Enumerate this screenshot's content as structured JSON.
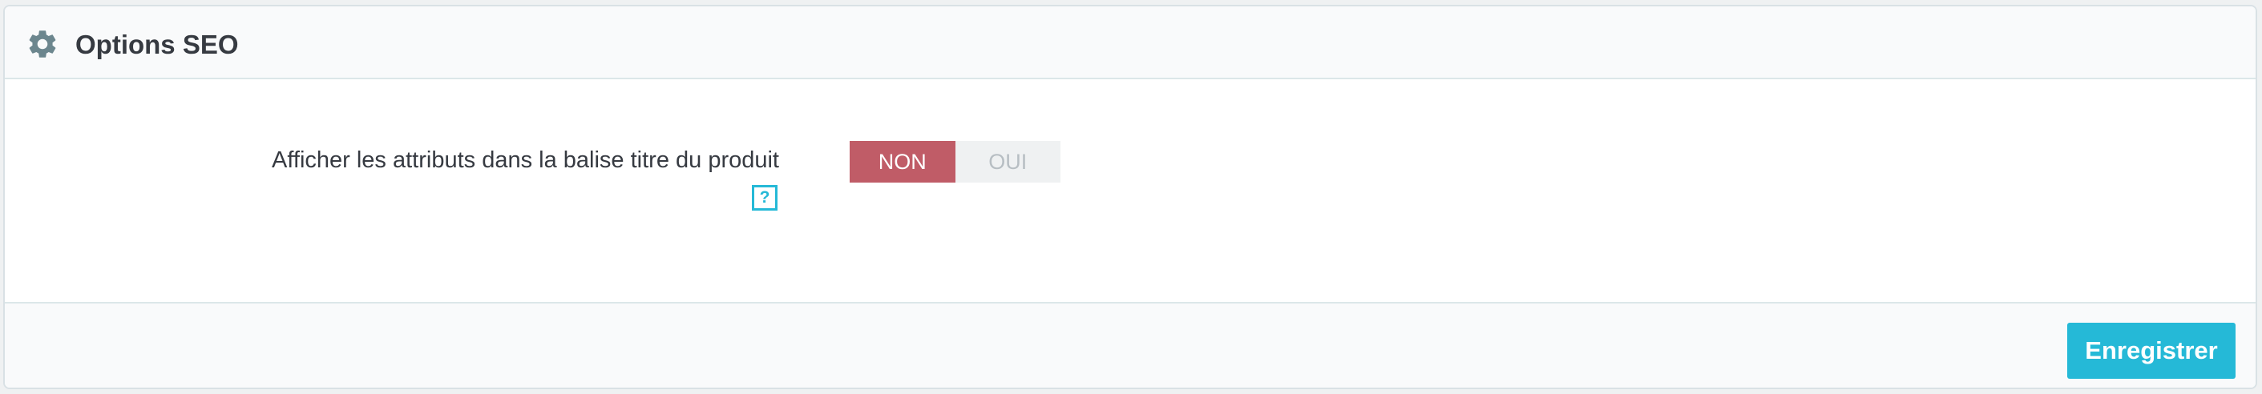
{
  "panel": {
    "title": "Options SEO",
    "icon": "gear-icon"
  },
  "form": {
    "label": "Afficher les attributs dans la balise titre du produit",
    "help_symbol": "?",
    "switch": {
      "options": [
        {
          "label": "NON",
          "selected": true
        },
        {
          "label": "OUI",
          "selected": false
        }
      ]
    }
  },
  "footer": {
    "save_label": "Enregistrer"
  },
  "colors": {
    "accent": "#25b9d7",
    "switch_selected": "#c05c67",
    "title_text": "#363a41",
    "icon": "#6c868e"
  }
}
